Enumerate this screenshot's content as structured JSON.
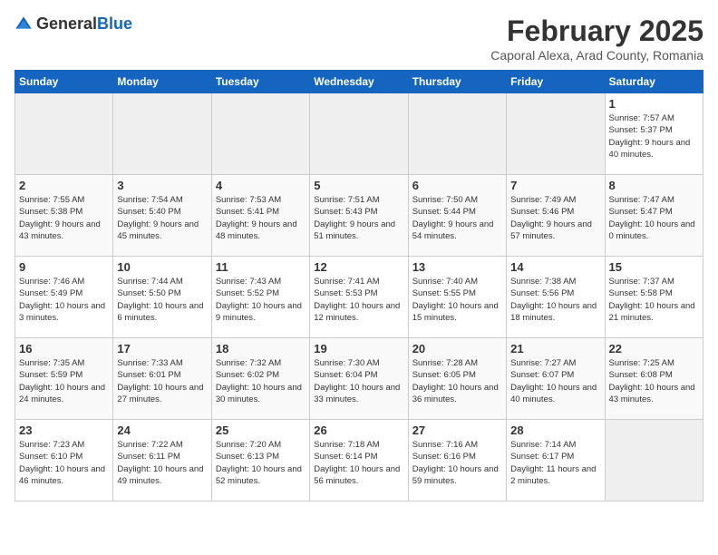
{
  "header": {
    "logo_general": "General",
    "logo_blue": "Blue",
    "title": "February 2025",
    "subtitle": "Caporal Alexa, Arad County, Romania"
  },
  "weekdays": [
    "Sunday",
    "Monday",
    "Tuesday",
    "Wednesday",
    "Thursday",
    "Friday",
    "Saturday"
  ],
  "weeks": [
    [
      {
        "day": "",
        "info": ""
      },
      {
        "day": "",
        "info": ""
      },
      {
        "day": "",
        "info": ""
      },
      {
        "day": "",
        "info": ""
      },
      {
        "day": "",
        "info": ""
      },
      {
        "day": "",
        "info": ""
      },
      {
        "day": "1",
        "info": "Sunrise: 7:57 AM\nSunset: 5:37 PM\nDaylight: 9 hours and 40 minutes."
      }
    ],
    [
      {
        "day": "2",
        "info": "Sunrise: 7:55 AM\nSunset: 5:38 PM\nDaylight: 9 hours and 43 minutes."
      },
      {
        "day": "3",
        "info": "Sunrise: 7:54 AM\nSunset: 5:40 PM\nDaylight: 9 hours and 45 minutes."
      },
      {
        "day": "4",
        "info": "Sunrise: 7:53 AM\nSunset: 5:41 PM\nDaylight: 9 hours and 48 minutes."
      },
      {
        "day": "5",
        "info": "Sunrise: 7:51 AM\nSunset: 5:43 PM\nDaylight: 9 hours and 51 minutes."
      },
      {
        "day": "6",
        "info": "Sunrise: 7:50 AM\nSunset: 5:44 PM\nDaylight: 9 hours and 54 minutes."
      },
      {
        "day": "7",
        "info": "Sunrise: 7:49 AM\nSunset: 5:46 PM\nDaylight: 9 hours and 57 minutes."
      },
      {
        "day": "8",
        "info": "Sunrise: 7:47 AM\nSunset: 5:47 PM\nDaylight: 10 hours and 0 minutes."
      }
    ],
    [
      {
        "day": "9",
        "info": "Sunrise: 7:46 AM\nSunset: 5:49 PM\nDaylight: 10 hours and 3 minutes."
      },
      {
        "day": "10",
        "info": "Sunrise: 7:44 AM\nSunset: 5:50 PM\nDaylight: 10 hours and 6 minutes."
      },
      {
        "day": "11",
        "info": "Sunrise: 7:43 AM\nSunset: 5:52 PM\nDaylight: 10 hours and 9 minutes."
      },
      {
        "day": "12",
        "info": "Sunrise: 7:41 AM\nSunset: 5:53 PM\nDaylight: 10 hours and 12 minutes."
      },
      {
        "day": "13",
        "info": "Sunrise: 7:40 AM\nSunset: 5:55 PM\nDaylight: 10 hours and 15 minutes."
      },
      {
        "day": "14",
        "info": "Sunrise: 7:38 AM\nSunset: 5:56 PM\nDaylight: 10 hours and 18 minutes."
      },
      {
        "day": "15",
        "info": "Sunrise: 7:37 AM\nSunset: 5:58 PM\nDaylight: 10 hours and 21 minutes."
      }
    ],
    [
      {
        "day": "16",
        "info": "Sunrise: 7:35 AM\nSunset: 5:59 PM\nDaylight: 10 hours and 24 minutes."
      },
      {
        "day": "17",
        "info": "Sunrise: 7:33 AM\nSunset: 6:01 PM\nDaylight: 10 hours and 27 minutes."
      },
      {
        "day": "18",
        "info": "Sunrise: 7:32 AM\nSunset: 6:02 PM\nDaylight: 10 hours and 30 minutes."
      },
      {
        "day": "19",
        "info": "Sunrise: 7:30 AM\nSunset: 6:04 PM\nDaylight: 10 hours and 33 minutes."
      },
      {
        "day": "20",
        "info": "Sunrise: 7:28 AM\nSunset: 6:05 PM\nDaylight: 10 hours and 36 minutes."
      },
      {
        "day": "21",
        "info": "Sunrise: 7:27 AM\nSunset: 6:07 PM\nDaylight: 10 hours and 40 minutes."
      },
      {
        "day": "22",
        "info": "Sunrise: 7:25 AM\nSunset: 6:08 PM\nDaylight: 10 hours and 43 minutes."
      }
    ],
    [
      {
        "day": "23",
        "info": "Sunrise: 7:23 AM\nSunset: 6:10 PM\nDaylight: 10 hours and 46 minutes."
      },
      {
        "day": "24",
        "info": "Sunrise: 7:22 AM\nSunset: 6:11 PM\nDaylight: 10 hours and 49 minutes."
      },
      {
        "day": "25",
        "info": "Sunrise: 7:20 AM\nSunset: 6:13 PM\nDaylight: 10 hours and 52 minutes."
      },
      {
        "day": "26",
        "info": "Sunrise: 7:18 AM\nSunset: 6:14 PM\nDaylight: 10 hours and 56 minutes."
      },
      {
        "day": "27",
        "info": "Sunrise: 7:16 AM\nSunset: 6:16 PM\nDaylight: 10 hours and 59 minutes."
      },
      {
        "day": "28",
        "info": "Sunrise: 7:14 AM\nSunset: 6:17 PM\nDaylight: 11 hours and 2 minutes."
      },
      {
        "day": "",
        "info": ""
      }
    ]
  ]
}
